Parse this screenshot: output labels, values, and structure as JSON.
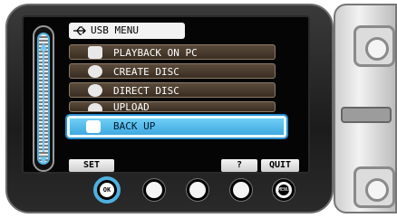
{
  "menu": {
    "title": "USB MENU",
    "items": [
      {
        "label": "PLAYBACK ON PC",
        "icon": "pc-icon"
      },
      {
        "label": "CREATE DISC",
        "icon": "disc-icon"
      },
      {
        "label": "DIRECT DISC",
        "icon": "direct-disc-icon"
      },
      {
        "label": "UPLOAD",
        "icon": "globe-icon"
      },
      {
        "label": "BACK UP",
        "icon": "backup-icon",
        "selected": true
      }
    ]
  },
  "softkeys": {
    "set": "SET",
    "help": "?",
    "quit": "QUIT"
  },
  "hardware": {
    "ok": "OK",
    "menu": "MENU"
  },
  "colors": {
    "selection": "#3fa8e0",
    "item_bg": "#3a2e22"
  }
}
